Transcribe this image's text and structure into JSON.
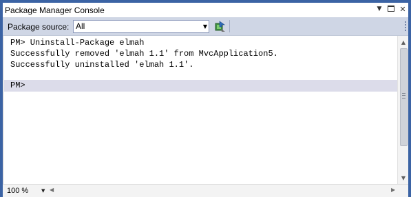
{
  "window": {
    "title": "Package Manager Console",
    "controls": {
      "dropdown_icon": "chevron-down-icon",
      "maximize_icon": "maximize-icon",
      "close_icon": "close-icon"
    }
  },
  "toolbar": {
    "source_label": "Package source:",
    "source_value": "All",
    "settings_icon": "package-settings-icon"
  },
  "console": {
    "lines": [
      "PM> Uninstall-Package elmah",
      "Successfully removed 'elmah 1.1' from MvcApplication5.",
      "Successfully uninstalled 'elmah 1.1'."
    ],
    "prompt": "PM>"
  },
  "statusbar": {
    "zoom": "100 %"
  },
  "colors": {
    "frame": "#3b63a4",
    "toolbar": "#cfd6e5",
    "prompt_highlight": "#dcdcea"
  }
}
